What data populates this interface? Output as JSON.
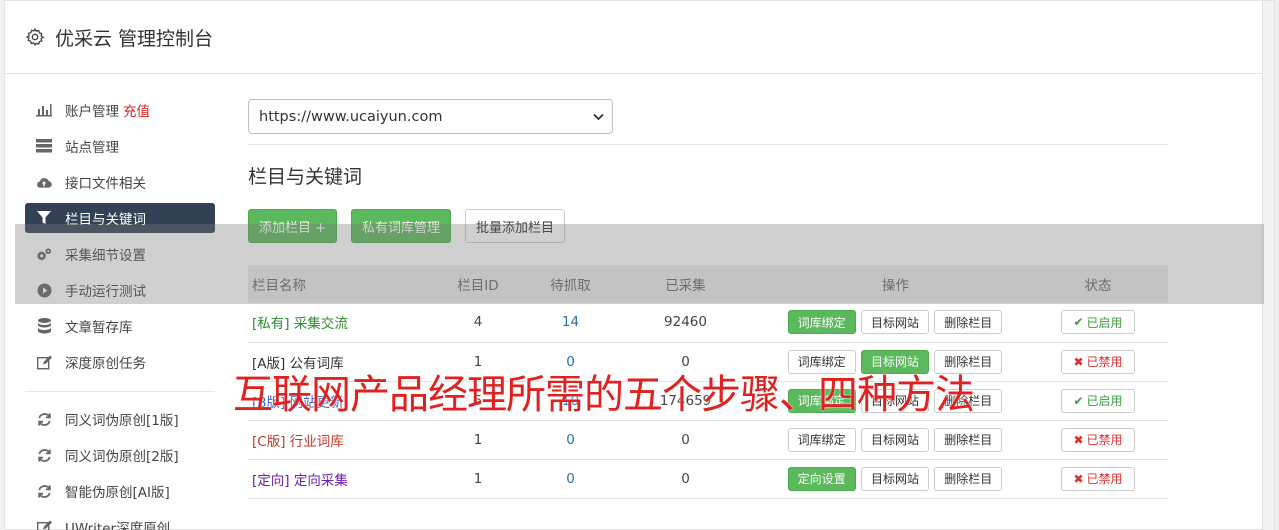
{
  "header": {
    "title": "优采云 管理控制台",
    "icon": "gear-icon"
  },
  "sidebar": {
    "items": [
      {
        "label": "账户管理",
        "extra": "充值",
        "icon": "bar-chart-icon"
      },
      {
        "label": "站点管理",
        "icon": "server-icon"
      },
      {
        "label": "接口文件相关",
        "icon": "cloud-upload-icon"
      },
      {
        "label": "栏目与关键词",
        "icon": "filter-icon",
        "active": true
      },
      {
        "label": "采集细节设置",
        "icon": "cogs-icon"
      },
      {
        "label": "手动运行测试",
        "icon": "play-circle-icon"
      },
      {
        "label": "文章暂存库",
        "icon": "database-icon"
      },
      {
        "label": "深度原创任务",
        "icon": "edit-icon"
      }
    ],
    "items2": [
      {
        "label": "同义词伪原创[1版]",
        "icon": "refresh-icon"
      },
      {
        "label": "同义词伪原创[2版]",
        "icon": "refresh-icon"
      },
      {
        "label": "智能伪原创[AI版]",
        "icon": "refresh-icon"
      },
      {
        "label": "UWriter深度原创",
        "icon": "edit-icon"
      }
    ]
  },
  "main": {
    "site_select": "https://www.ucaiyun.com",
    "section_title": "栏目与关键词",
    "buttons": {
      "add_column": "添加栏目 +",
      "private_lib": "私有词库管理",
      "batch_add": "批量添加栏目"
    },
    "table": {
      "headers": [
        "栏目名称",
        "栏目ID",
        "待抓取",
        "已采集",
        "操作",
        "状态"
      ],
      "rows": [
        {
          "tag": "[私有]",
          "name": "采集交流",
          "tag_color": "#2e8b2e",
          "id": "4",
          "pending": "14",
          "collected": "92460",
          "op1": "词库绑定",
          "op1_green": true,
          "op2": "目标网站",
          "op2_green": false,
          "op3": "删除栏目",
          "status": "已启用",
          "enabled": true
        },
        {
          "tag": "[A版]",
          "name": "公有词库",
          "tag_color": "#333333",
          "id": "1",
          "pending": "0",
          "collected": "0",
          "op1": "词库绑定",
          "op1_green": false,
          "op2": "目标网站",
          "op2_green": true,
          "op3": "删除栏目",
          "status": "已禁用",
          "enabled": false
        },
        {
          "tag": "[B版]",
          "name": "网站更新",
          "tag_color": "#3a5fcd",
          "id": "5",
          "pending": "10",
          "collected": "174659",
          "op1": "词库绑定",
          "op1_green": true,
          "op2": "目标网站",
          "op2_green": false,
          "op3": "删除栏目",
          "status": "已启用",
          "enabled": true
        },
        {
          "tag": "[C版]",
          "name": "行业词库",
          "tag_color": "#c0392b",
          "id": "1",
          "pending": "0",
          "collected": "0",
          "op1": "词库绑定",
          "op1_green": false,
          "op2": "目标网站",
          "op2_green": false,
          "op3": "删除栏目",
          "status": "已禁用",
          "enabled": false
        },
        {
          "tag": "[定向]",
          "name": "定向采集",
          "tag_color": "#6a1fb5",
          "id": "1",
          "pending": "0",
          "collected": "0",
          "op1": "定向设置",
          "op1_green": true,
          "op2": "目标网站",
          "op2_green": false,
          "op3": "删除栏目",
          "status": "已禁用",
          "enabled": false
        }
      ]
    }
  },
  "overlay": {
    "text": "互联网产品经理所需的五个步骤、四种方法"
  }
}
